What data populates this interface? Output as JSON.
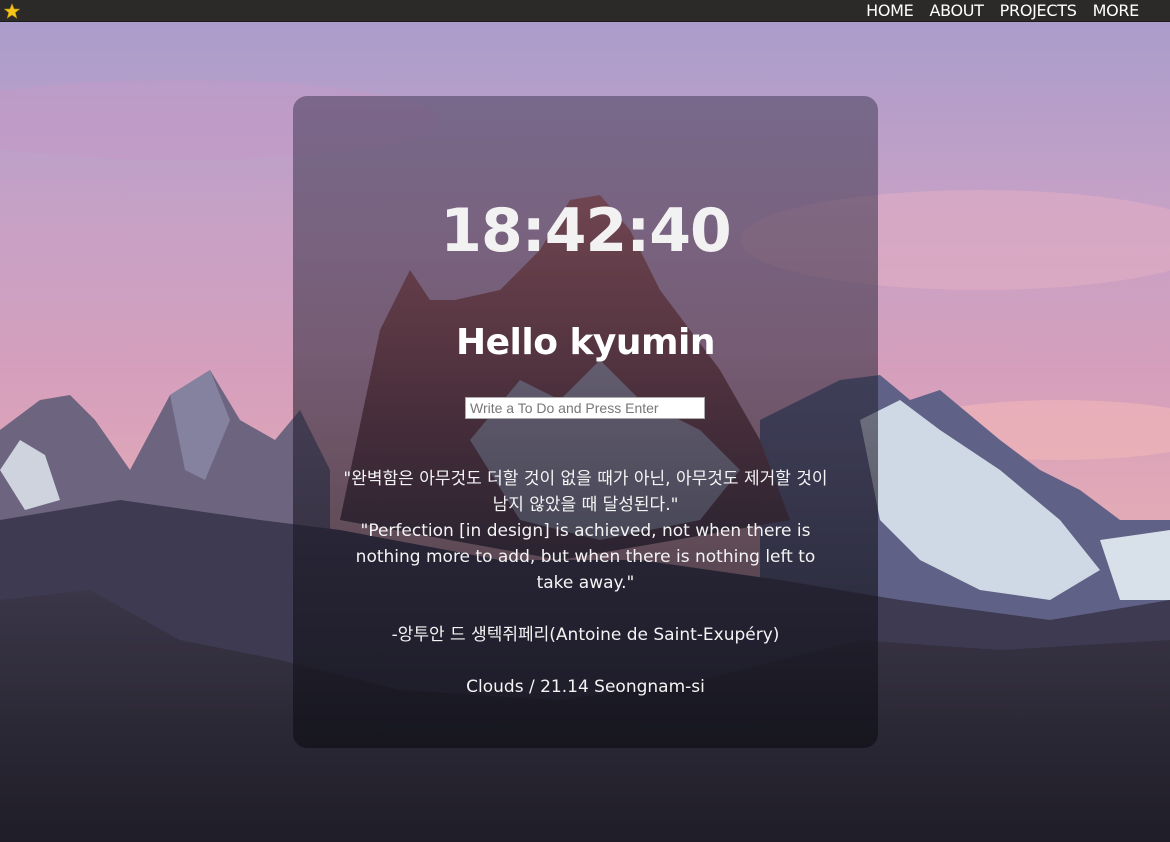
{
  "nav": {
    "logo_icon": "star-icon",
    "items": [
      {
        "label": "HOME"
      },
      {
        "label": "ABOUT"
      },
      {
        "label": "PROJECTS"
      },
      {
        "label": "MORE"
      }
    ]
  },
  "card": {
    "clock": "18:42:40",
    "greeting": "Hello kyumin",
    "todo_placeholder": "Write a To Do and Press Enter",
    "todo_value": "",
    "quote_ko": "\"완벽함은 아무것도 더할 것이 없을 때가 아닌, 아무것도 제거할 것이 남지 않았을 때 달성된다.\"",
    "quote_en": "\"Perfection [in design] is achieved, not when there is nothing more to add, but when there is nothing left to take away.\"",
    "author": "-앙투안 드 생텍쥐페리(Antoine de Saint-Exupéry)",
    "weather": "Clouds / 21.14 Seongnam-si"
  },
  "colors": {
    "navbar": "#2b2a28",
    "star": "#f5c518",
    "text": "#ffffff"
  }
}
